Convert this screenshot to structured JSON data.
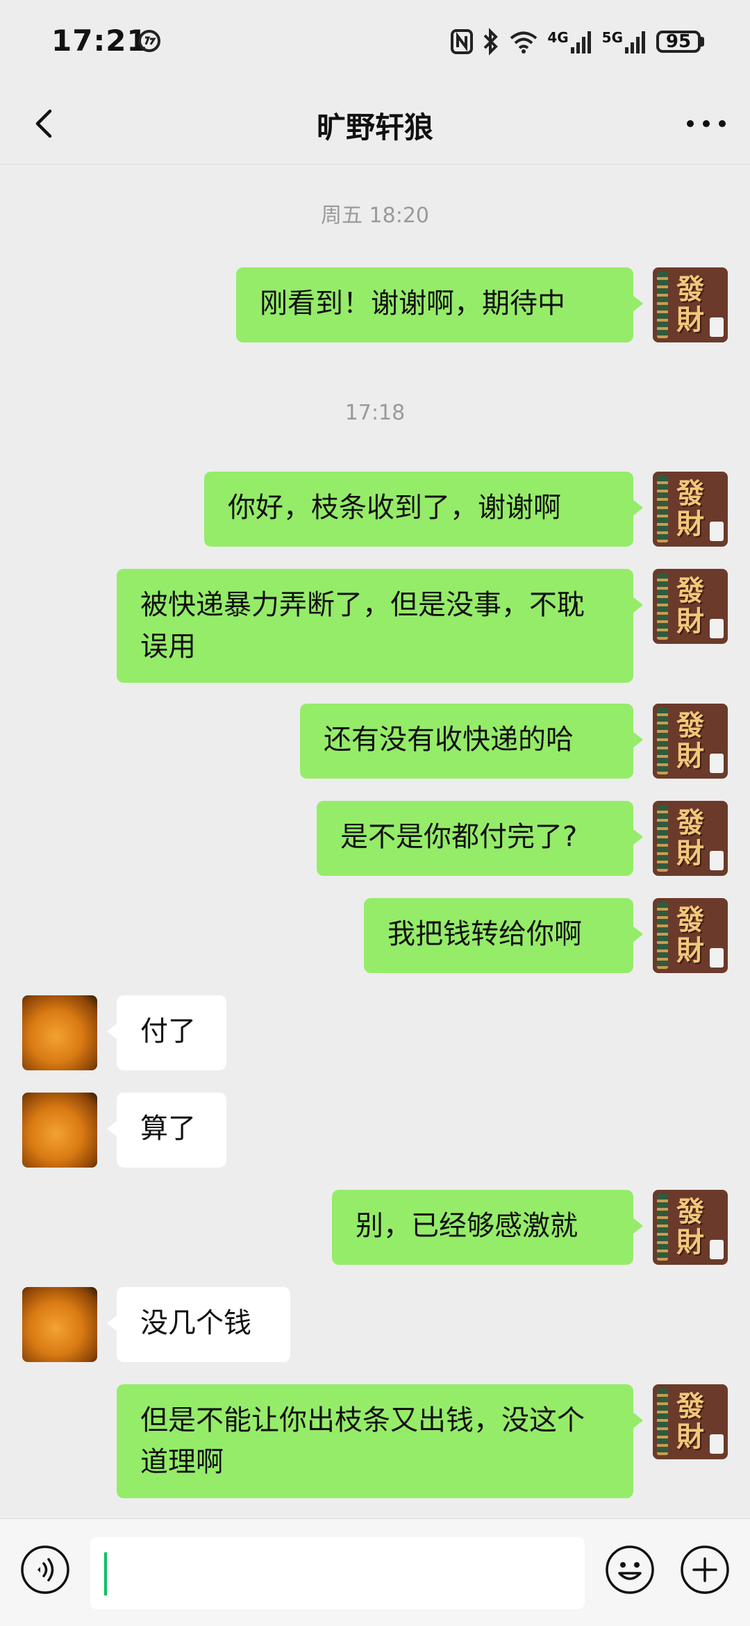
{
  "status_bar": {
    "time": "17:21",
    "network": "4G",
    "network2": "5G",
    "battery": "95"
  },
  "header": {
    "title": "旷野轩狼"
  },
  "avatars": {
    "me_glyph_top": "發",
    "me_glyph_bottom": "財"
  },
  "messages": [
    {
      "type": "time",
      "text": "周五 18:20"
    },
    {
      "type": "msg",
      "from": "me",
      "text": "刚看到！谢谢啊，期待中"
    },
    {
      "type": "time",
      "text": "17:18"
    },
    {
      "type": "msg",
      "from": "me",
      "text": "你好，枝条收到了，谢谢啊"
    },
    {
      "type": "msg",
      "from": "me",
      "text": "被快递暴力弄断了，但是没事，不耽误用"
    },
    {
      "type": "msg",
      "from": "me",
      "text": "还有没有收快递的哈"
    },
    {
      "type": "msg",
      "from": "me",
      "text": "是不是你都付完了?"
    },
    {
      "type": "msg",
      "from": "me",
      "text": "我把钱转给你啊"
    },
    {
      "type": "msg",
      "from": "them",
      "text": "付了"
    },
    {
      "type": "msg",
      "from": "them",
      "text": "算了"
    },
    {
      "type": "msg",
      "from": "me",
      "text": "别，已经够感激就"
    },
    {
      "type": "msg",
      "from": "them",
      "text": "没几个钱"
    },
    {
      "type": "msg",
      "from": "me",
      "text": "但是不能让你出枝条又出钱，没这个道理啊"
    }
  ],
  "input": {
    "value": "",
    "placeholder": ""
  },
  "icons": {
    "back": "chevron-left-icon",
    "more": "more-dots-icon",
    "voice": "voice-icon",
    "emoji": "emoji-icon",
    "plus": "plus-icon"
  },
  "colors": {
    "bubble_me": "#95ec69",
    "bubble_them": "#ffffff",
    "background": "#ededed",
    "caret": "#07c160"
  }
}
